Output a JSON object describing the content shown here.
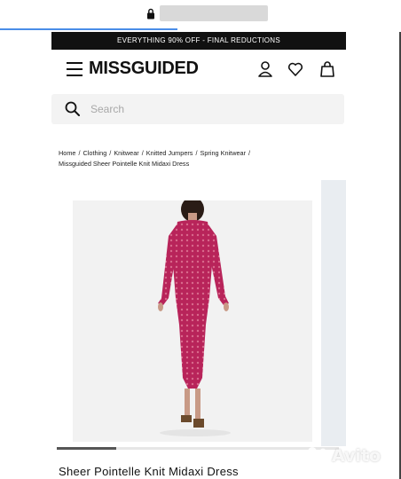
{
  "browser": {
    "lock_icon": "lock-icon"
  },
  "promo_banner": {
    "text": "EVERYTHING 90% OFF - FINAL REDUCTIONS"
  },
  "header": {
    "logo": "MISSGUIDED",
    "icons": [
      "menu-icon",
      "account-icon",
      "wishlist-heart-icon",
      "bag-icon"
    ]
  },
  "search": {
    "placeholder": "Search",
    "icon": "search-icon"
  },
  "breadcrumb": {
    "items": [
      "Home",
      "Clothing",
      "Knitwear",
      "Knitted Jumpers",
      "Spring Knitwear",
      "Missguided Sheer Pointelle Knit Midaxi Dress"
    ],
    "separator": "/"
  },
  "product": {
    "title": "Sheer Pointelle Knit Midaxi Dress",
    "image_carousel_progress": 0.21,
    "dress_color": "#b8245a"
  },
  "watermark": {
    "text": "Avito"
  }
}
